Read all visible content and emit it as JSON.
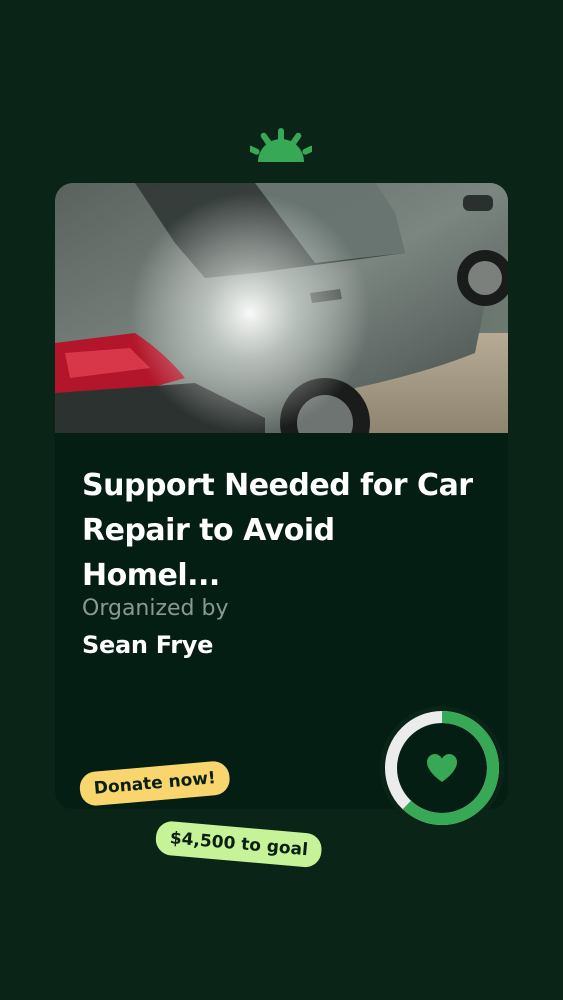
{
  "brand": {
    "logo_icon": "gofundme-sun-icon",
    "accent_color": "#37a856"
  },
  "campaign": {
    "image": {
      "description_icon": "car-photo",
      "subject": "damaged gray hatchback car"
    },
    "title": "Support Needed for Car Repair to Avoid Homel...",
    "organizer_label": "Organized by",
    "organizer_name": "Sean Frye",
    "progress_fraction": 0.62,
    "heart_icon": "heart-icon"
  },
  "tags": {
    "donate_label": "Donate now!",
    "goal_label": "$4,500 to goal"
  },
  "colors": {
    "background": "#0b2418",
    "card": "#041e14",
    "progress_track": "#ececec",
    "progress_fill": "#37a856",
    "donate_tag": "#f9d56e",
    "goal_tag": "#c6f398"
  }
}
